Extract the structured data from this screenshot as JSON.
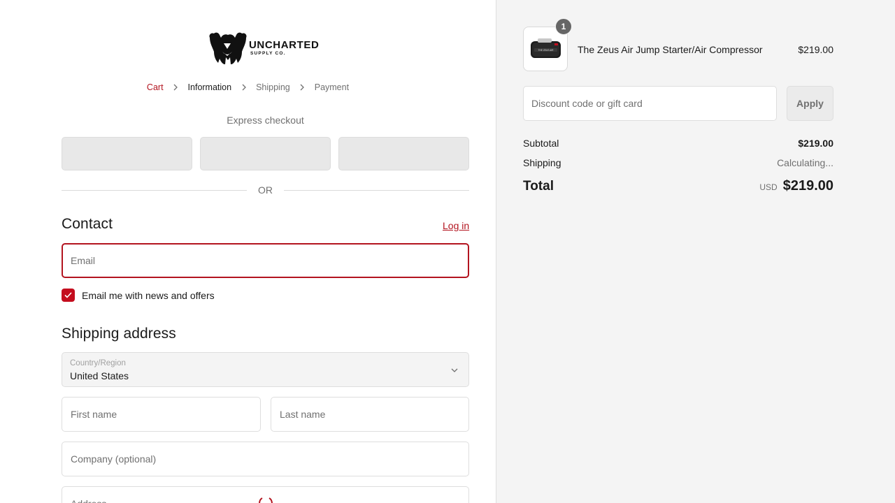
{
  "brand": {
    "name": "UNCHARTED",
    "tagline": "SUPPLY CO."
  },
  "breadcrumb": {
    "items": [
      "Cart",
      "Information",
      "Shipping",
      "Payment"
    ],
    "current": "Information"
  },
  "express_checkout": {
    "title": "Express checkout",
    "buttons": [
      "",
      "",
      ""
    ]
  },
  "divider_text": "OR",
  "contact": {
    "title": "Contact",
    "login_label": "Log in",
    "email_placeholder": "Email",
    "email_value": "",
    "newsletter_label": "Email me with news and offers",
    "newsletter_checked": true
  },
  "shipping_address": {
    "title": "Shipping address",
    "country_label": "Country/Region",
    "country_value": "United States",
    "first_name_placeholder": "First name",
    "last_name_placeholder": "Last name",
    "company_placeholder": "Company (optional)",
    "address_placeholder": "Address"
  },
  "order_summary": {
    "item": {
      "name": "The Zeus Air Jump Starter/Air Compressor",
      "price": "$219.00",
      "quantity": "1",
      "image_label": "THE ZEUS AIR"
    },
    "discount_placeholder": "Discount code or gift card",
    "apply_label": "Apply",
    "subtotal_label": "Subtotal",
    "subtotal_value": "$219.00",
    "shipping_label": "Shipping",
    "shipping_value": "Calculating...",
    "total_label": "Total",
    "currency": "USD",
    "total_value": "$219.00"
  },
  "colors": {
    "accent": "#b3141f",
    "checkbox": "#c40d1e",
    "aside_bg": "#f4f4f4"
  }
}
